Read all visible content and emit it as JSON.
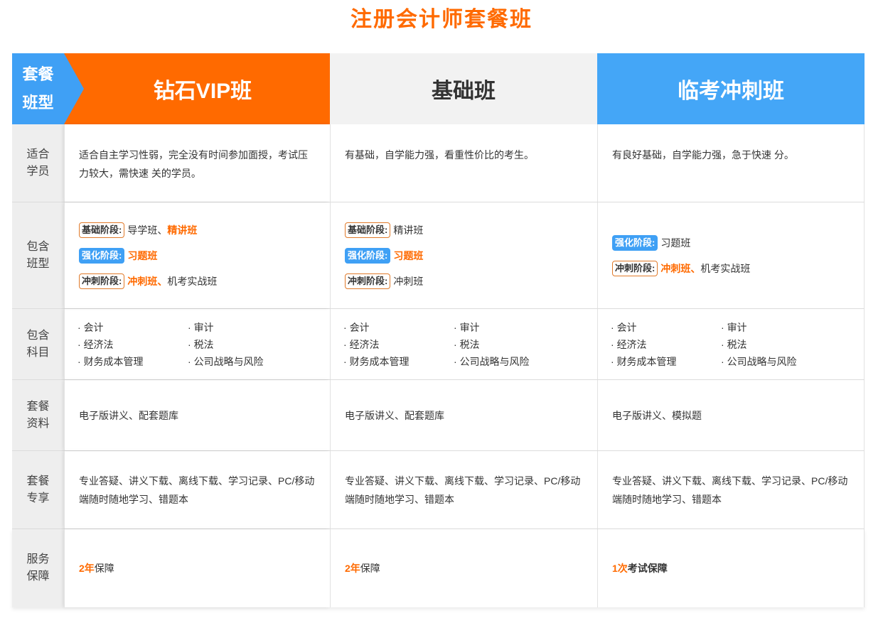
{
  "page": {
    "title": "注册会计师套餐班"
  },
  "header": {
    "corner": [
      "套餐",
      "班型"
    ],
    "plans": [
      "钻石VIP班",
      "基础班",
      "临考冲刺班"
    ]
  },
  "rows": {
    "audience": {
      "label": [
        "适合",
        "学员"
      ],
      "values": [
        "适合自主学习性弱，完全没有时间参加面授，考试压力较大，需快速  关的学员。",
        "有基础，自学能力强，看重性价比的考生。",
        "有良好基础，自学能力强，急于快速 分。"
      ]
    },
    "classes": {
      "label": [
        "包含",
        "班型"
      ],
      "plan1": [
        {
          "stage": "基础阶段:",
          "items": "导学班、",
          "highlight": "精讲班"
        },
        {
          "stage": "强化阶段:",
          "items": "",
          "highlight": "习题班"
        },
        {
          "stage": "冲刺阶段:",
          "items": "",
          "highlight": "冲刺班、",
          "tail": "机考实战班"
        }
      ],
      "plan2": [
        {
          "stage": "基础阶段:",
          "items": "精讲班"
        },
        {
          "stage": "强化阶段:",
          "highlight": "习题班"
        },
        {
          "stage": "冲刺阶段:",
          "items": "冲刺班"
        }
      ],
      "plan3": [
        {
          "stage": "强化阶段:",
          "items": "习题班"
        },
        {
          "stage": "冲刺阶段:",
          "highlight": "冲刺班、",
          "tail": "机考实战班"
        }
      ]
    },
    "subjects": {
      "label": [
        "包含",
        "科目"
      ],
      "items": [
        "会计",
        "审计",
        "经济法",
        "税法",
        "财务成本管理",
        "公司战略与风险"
      ]
    },
    "materials": {
      "label": [
        "套餐",
        "资料"
      ],
      "values": [
        "电子版讲义、配套题库",
        "电子版讲义、配套题库",
        "电子版讲义、模拟题"
      ]
    },
    "perks": {
      "label": [
        "套餐",
        "专享"
      ],
      "values": [
        "专业答疑、讲义下载、离线下载、学习记录、PC/移动端随时随地学习、错题本",
        "专业答疑、讲义下载、离线下载、学习记录、PC/移动端随时随地学习、错题本",
        "专业答疑、讲义下载、离线下载、学习记录、PC/移动端随时随地学习、错题本"
      ]
    },
    "service": {
      "label": [
        "服务",
        "保障"
      ],
      "values": [
        {
          "num": "2年",
          "text": "保障"
        },
        {
          "num": "2年",
          "text": "保障"
        },
        {
          "num": "1次",
          "text": "考试保障"
        }
      ]
    }
  },
  "colors": {
    "accent": "#ff6a00",
    "blue": "#3fa0f5",
    "grey": "#f2f2f2"
  }
}
